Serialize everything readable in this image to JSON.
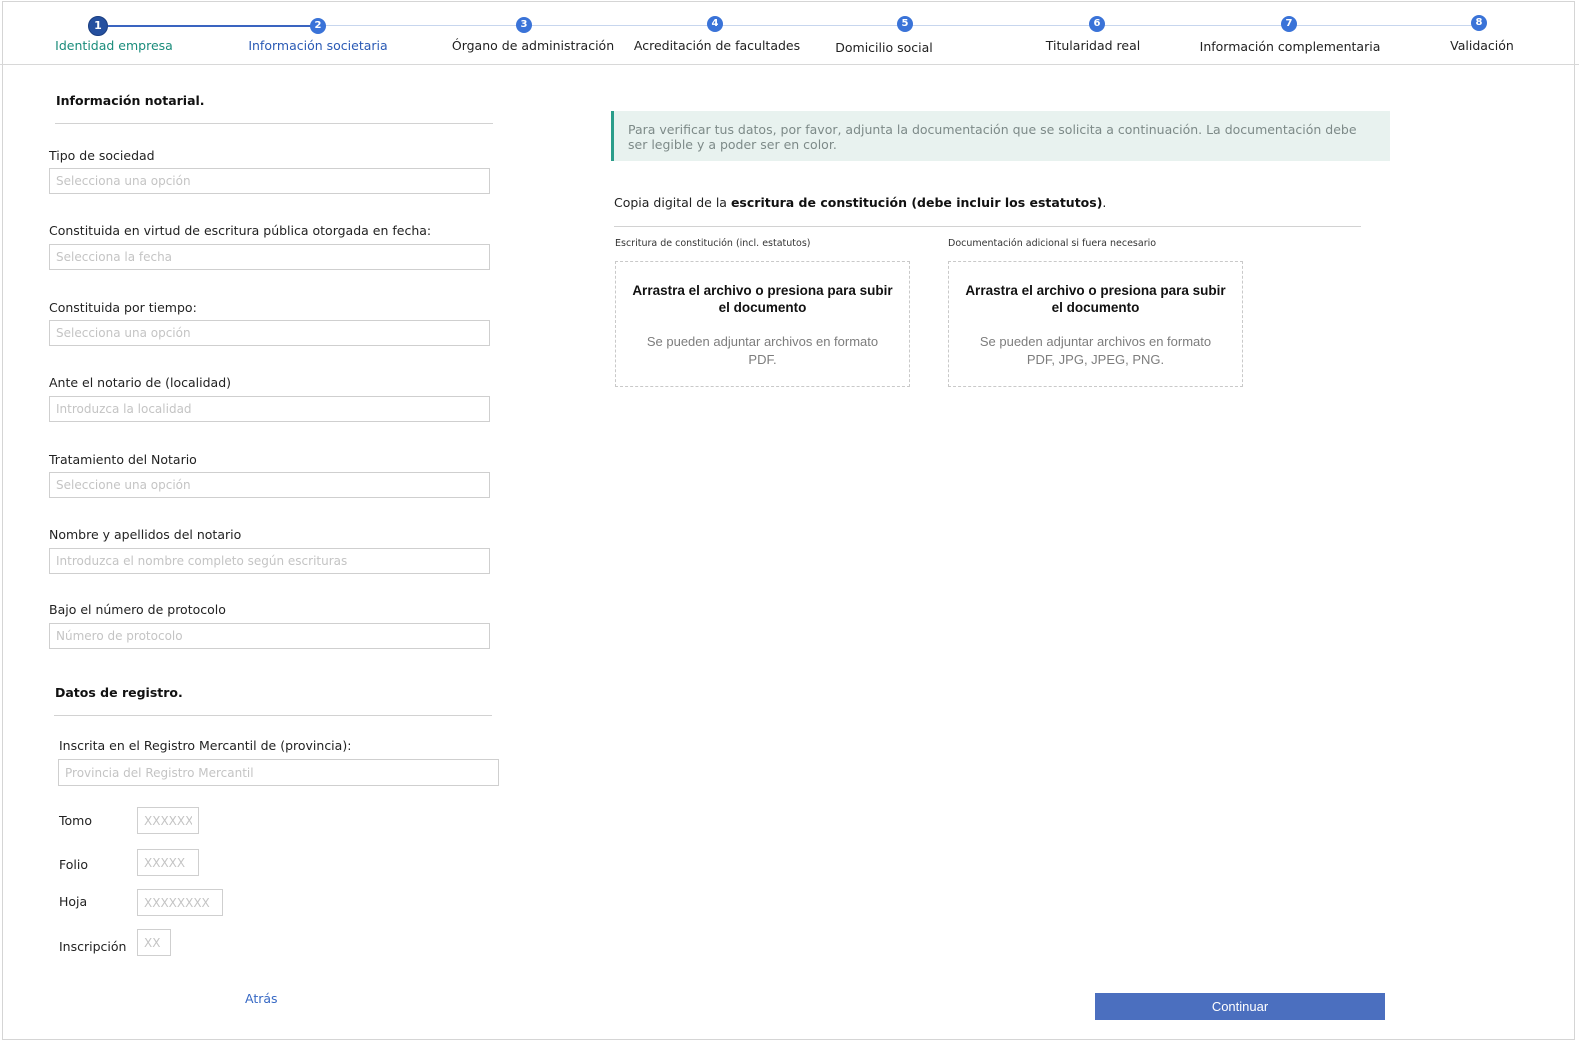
{
  "stepper": {
    "steps": [
      {
        "number": "1",
        "label": "Identidad empresa"
      },
      {
        "number": "2",
        "label": "Información societaria"
      },
      {
        "number": "3",
        "label": "Órgano de administración"
      },
      {
        "number": "4",
        "label": "Acreditación de facultades"
      },
      {
        "number": "5",
        "label": "Domicilio social"
      },
      {
        "number": "6",
        "label": "Titularidad real"
      },
      {
        "number": "7",
        "label": "Información complementaria"
      },
      {
        "number": "8",
        "label": "Validación"
      }
    ]
  },
  "notarial": {
    "title": "Información notarial.",
    "fields": [
      {
        "label": "Tipo de sociedad",
        "placeholder": "Selecciona una opción"
      },
      {
        "label": "Constituida en virtud de escritura pública otorgada en fecha:",
        "placeholder": "Selecciona la fecha"
      },
      {
        "label": "Constituida por tiempo:",
        "placeholder": "Selecciona una opción"
      },
      {
        "label": "Ante el notario de (localidad)",
        "placeholder": "Introduzca la localidad"
      },
      {
        "label": "Tratamiento del Notario",
        "placeholder": "Seleccione una opción"
      },
      {
        "label": "Nombre y apellidos del notario",
        "placeholder": "Introduzca el nombre completo según escrituras"
      },
      {
        "label": "Bajo el número de protocolo",
        "placeholder": "Número de protocolo"
      }
    ]
  },
  "registro": {
    "title": "Datos de registro.",
    "provincia_label": "Inscrita en el Registro Mercantil de (provincia):",
    "provincia_placeholder": "Provincia del Registro Mercantil",
    "tomo_label": "Tomo",
    "tomo_placeholder": "XXXXXX",
    "folio_label": "Folio",
    "folio_placeholder": "XXXXX",
    "hoja_label": "Hoja",
    "hoja_placeholder": "XXXXXXXX",
    "inscripcion_label": "Inscripción",
    "inscripcion_placeholder": "XX"
  },
  "info_text": "Para verificar tus datos, por favor, adjunta la documentación que se solicita a continuación. La documentación debe ser legible y a poder ser en color.",
  "copy": {
    "prefix": "Copia digital de la ",
    "bold": "escritura de constitución (debe incluir los estatutos)",
    "suffix": "."
  },
  "uploads": [
    {
      "label": "Escritura  de  constitución  (incl.  estatutos)",
      "main": "Arrastra el archivo o presiona para subir el documento",
      "sub": "Se pueden adjuntar archivos en formato PDF."
    },
    {
      "label": "Documentación  adicional  si fuera necesario",
      "main": "Arrastra el archivo o presiona para subir el documento",
      "sub": "Se pueden adjuntar archivos en formato PDF, JPG, JPEG, PNG."
    }
  ],
  "actions": {
    "back": "Atrás",
    "continue": "Continuar"
  },
  "colors": {
    "accent": "#3a73d8",
    "current_step": "#25509f",
    "current_label": "#1a8c7b",
    "info_bg": "#e8f2ef",
    "info_border": "#2a9d8a",
    "button": "#4b6fbf"
  }
}
